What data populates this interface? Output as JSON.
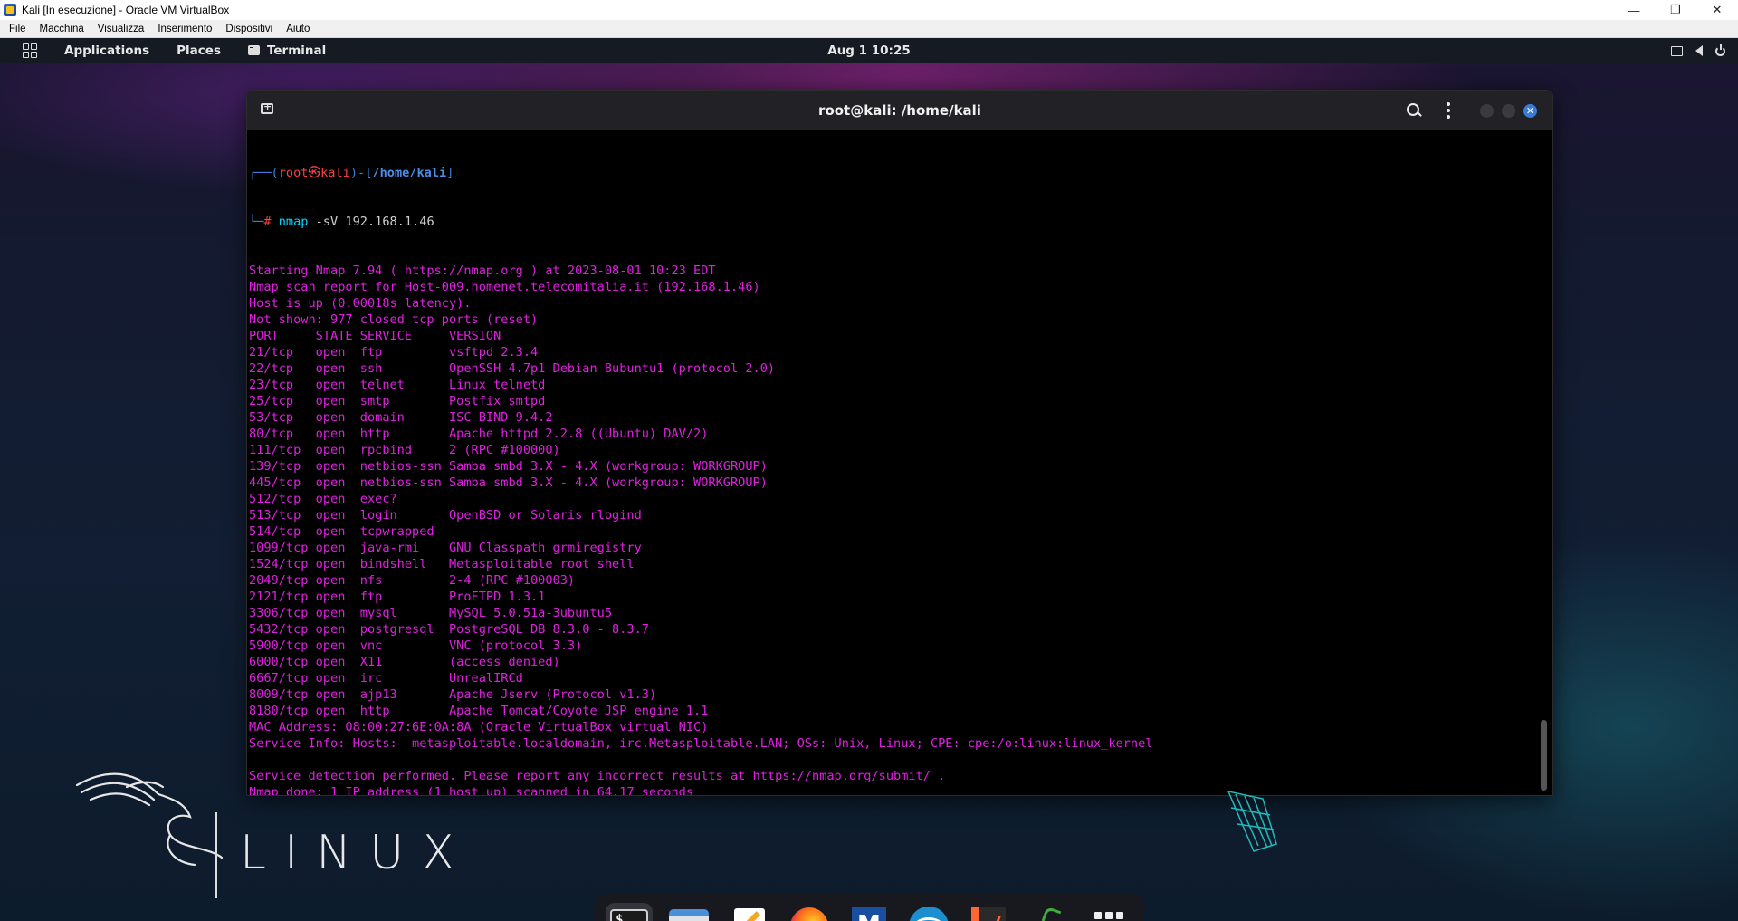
{
  "host": {
    "window_title": "Kali [In esecuzione] - Oracle VM VirtualBox",
    "controls": {
      "minimize": "—",
      "restore": "❐",
      "close": "✕"
    }
  },
  "vbox_menu": [
    "File",
    "Macchina",
    "Visualizza",
    "Inserimento",
    "Dispositivi",
    "Aiuto"
  ],
  "panel": {
    "applications": "Applications",
    "places": "Places",
    "active_app": "Terminal",
    "clock": "Aug 1  10:25"
  },
  "terminal": {
    "title": "root@kali: /home/kali",
    "close_glyph": "✕",
    "prompt": {
      "top_open": "┌──(",
      "user": "root㉿kali",
      "mid": ")-[",
      "path": "/home/kali",
      "top_close": "]",
      "bottom": "└─",
      "hash": "#"
    },
    "command": {
      "name": "nmap",
      "args": " -sV 192.168.1.46"
    },
    "output": [
      "Starting Nmap 7.94 ( https://nmap.org ) at 2023-08-01 10:23 EDT",
      "Nmap scan report for Host-009.homenet.telecomitalia.it (192.168.1.46)",
      "Host is up (0.00018s latency).",
      "Not shown: 977 closed tcp ports (reset)",
      "PORT     STATE SERVICE     VERSION",
      "21/tcp   open  ftp         vsftpd 2.3.4",
      "22/tcp   open  ssh         OpenSSH 4.7p1 Debian 8ubuntu1 (protocol 2.0)",
      "23/tcp   open  telnet      Linux telnetd",
      "25/tcp   open  smtp        Postfix smtpd",
      "53/tcp   open  domain      ISC BIND 9.4.2",
      "80/tcp   open  http        Apache httpd 2.2.8 ((Ubuntu) DAV/2)",
      "111/tcp  open  rpcbind     2 (RPC #100000)",
      "139/tcp  open  netbios-ssn Samba smbd 3.X - 4.X (workgroup: WORKGROUP)",
      "445/tcp  open  netbios-ssn Samba smbd 3.X - 4.X (workgroup: WORKGROUP)",
      "512/tcp  open  exec?",
      "513/tcp  open  login       OpenBSD or Solaris rlogind",
      "514/tcp  open  tcpwrapped",
      "1099/tcp open  java-rmi    GNU Classpath grmiregistry",
      "1524/tcp open  bindshell   Metasploitable root shell",
      "2049/tcp open  nfs         2-4 (RPC #100003)",
      "2121/tcp open  ftp         ProFTPD 1.3.1",
      "3306/tcp open  mysql       MySQL 5.0.51a-3ubuntu5",
      "5432/tcp open  postgresql  PostgreSQL DB 8.3.0 - 8.3.7",
      "5900/tcp open  vnc         VNC (protocol 3.3)",
      "6000/tcp open  X11         (access denied)",
      "6667/tcp open  irc         UnrealIRCd",
      "8009/tcp open  ajp13       Apache Jserv (Protocol v1.3)",
      "8180/tcp open  http        Apache Tomcat/Coyote JSP engine 1.1",
      "MAC Address: 08:00:27:6E:0A:8A (Oracle VirtualBox virtual NIC)",
      "Service Info: Hosts:  metasploitable.localdomain, irc.Metasploitable.LAN; OSs: Unix, Linux; CPE: cpe:/o:linux:linux_kernel",
      "",
      "Service detection performed. Please report any incorrect results at https://nmap.org/submit/ .",
      "Nmap done: 1 IP address (1 host up) scanned in 64.17 seconds",
      ""
    ]
  },
  "wallpaper": {
    "brand_text": "LINUX"
  },
  "dock": [
    {
      "name": "terminal",
      "glyph": "$_"
    },
    {
      "name": "files"
    },
    {
      "name": "text-editor"
    },
    {
      "name": "firefox"
    },
    {
      "name": "metasploit",
      "glyph": "M"
    },
    {
      "name": "wireshark"
    },
    {
      "name": "burpsuite"
    },
    {
      "name": "cherrytree"
    },
    {
      "name": "show-apps"
    }
  ],
  "colors": {
    "prompt_frame": "#3e7be0",
    "prompt_user": "#ff4040",
    "prompt_path": "#4d8de8",
    "output_text": "#e020e0",
    "command": "#00d7ff",
    "cursor": "#2ee045"
  }
}
